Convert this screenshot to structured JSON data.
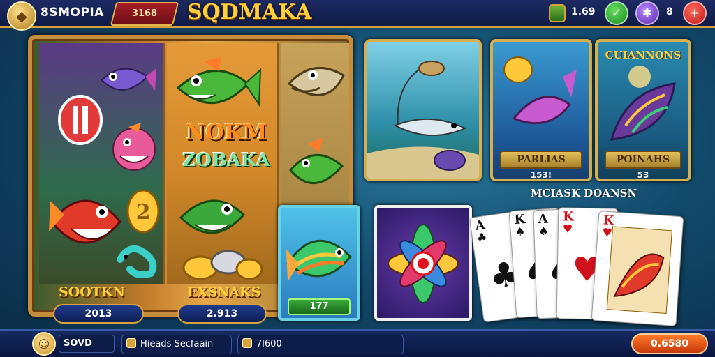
{
  "header": {
    "brand": "8SMOPIA",
    "tag": "3168",
    "title": "SQDMAKA",
    "balance": "1.69",
    "count": "8",
    "icons": [
      "logo-badge-icon",
      "treasure-chest-icon",
      "checkmark-icon",
      "pinwheel-icon",
      "plus-icon"
    ]
  },
  "slot": {
    "center_word": "NOKM",
    "center_word_sub": "ZOBAKA",
    "reel1_label": "SOOTKN",
    "reel2_label": "EXSNAKS",
    "reel1_value": "2013",
    "reel2_value": "2.913"
  },
  "cards": [
    {
      "title": "",
      "banner": "",
      "sub": ""
    },
    {
      "title": "",
      "banner": "PARLIAS",
      "sub": "153!"
    },
    {
      "title": "CUIANNONS",
      "banner": "POINAHS",
      "sub": "53"
    }
  ],
  "section_label": "MCIASK DOANSN",
  "tile_fish_value": "177",
  "playing_cards": [
    {
      "rank": "A",
      "suit": "♣",
      "color": "black"
    },
    {
      "rank": "K",
      "suit": "♠",
      "color": "black"
    },
    {
      "rank": "A",
      "suit": "♠",
      "color": "black"
    },
    {
      "rank": "K",
      "suit": "♥",
      "color": "red"
    },
    {
      "rank": "K",
      "suit": "♥",
      "color": "red"
    }
  ],
  "footer": {
    "username": "SOVD",
    "field1": "Hieads Secfaain",
    "field2": "7l600",
    "cta": "0.6580"
  },
  "colors": {
    "accent_gold": "#d7a23b",
    "title_yellow": "#ffcf3a",
    "cta_orange": "#ff7a2a"
  }
}
